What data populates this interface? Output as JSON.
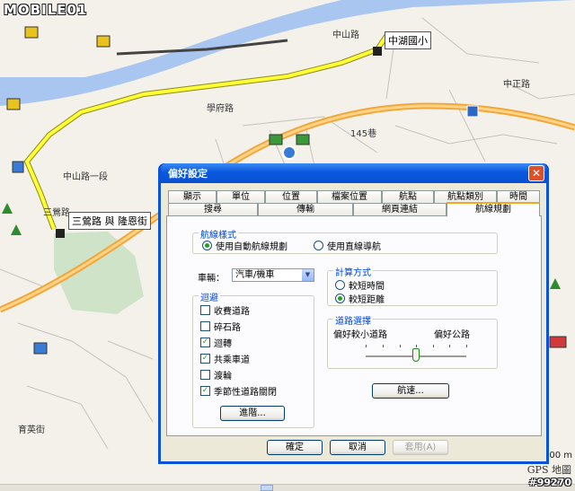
{
  "watermark": "MOBILE01",
  "photo_id": "#99270",
  "map": {
    "labels": [
      "中山路",
      "三鶯路",
      "145巷",
      "中山路一段",
      "中正路",
      "育英街",
      "鶯歌",
      "文化路",
      "學府路"
    ],
    "poi_1": "中湖國小",
    "poi_2": "三鶯路 與 隆恩街",
    "credit": "GPS 地圖",
    "scale": "700 m"
  },
  "dialog": {
    "title": "偏好設定",
    "tabs_row1": [
      "顯示",
      "單位",
      "位置",
      "檔案位置",
      "航點",
      "航點類別",
      "時間"
    ],
    "tabs_row2": [
      "搜尋",
      "傳輸",
      "網頁連結",
      "航線規劃"
    ],
    "active_tab": "航線規劃",
    "route_style": {
      "title": "航線樣式",
      "auto": "使用自動航線規劃",
      "direct": "使用直線導航",
      "selected": "auto"
    },
    "vehicle": {
      "label": "車輛：",
      "value": "汽車/機車"
    },
    "calc": {
      "title": "計算方式",
      "options": [
        "較短時間",
        "較短距離"
      ],
      "selected": 1
    },
    "avoid": {
      "title": "迴避",
      "items": [
        {
          "label": "收費道路",
          "checked": false
        },
        {
          "label": "碎石路",
          "checked": false
        },
        {
          "label": "迴轉",
          "checked": true
        },
        {
          "label": "共乘車道",
          "checked": true
        },
        {
          "label": "渡輪",
          "checked": false
        },
        {
          "label": "季節性道路關閉",
          "checked": true
        }
      ],
      "advanced": "進階..."
    },
    "road": {
      "title": "道路選擇",
      "left": "偏好較小道路",
      "right": "偏好公路",
      "level": 0.5
    },
    "speed_button": "航速...",
    "ok": "確定",
    "cancel": "取消",
    "apply": "套用(A)"
  },
  "colors": {
    "water": "#a9c6f1",
    "road_major": "#f2a73a",
    "route": "#ffff33",
    "park": "#cfe3c8",
    "dialog_frame": "#0a52d8"
  }
}
